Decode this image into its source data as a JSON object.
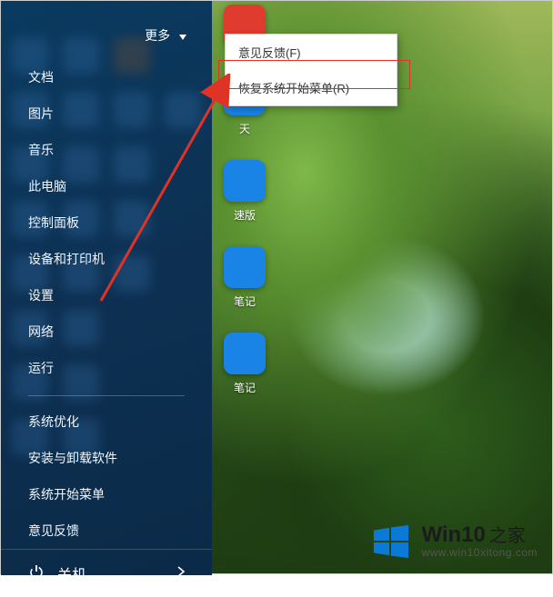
{
  "more_label": "更多",
  "menu_groups": {
    "g1": [
      "文档",
      "图片",
      "音乐",
      "此电脑",
      "控制面板",
      "设备和打印机",
      "设置",
      "网络",
      "运行"
    ],
    "g2": [
      "系统优化",
      "安装与卸载软件",
      "系统开始菜单",
      "意见反馈"
    ]
  },
  "shutdown_label": "关机",
  "context_menu": {
    "items": [
      "意见反馈(F)",
      "恢复系统开始菜单(R)"
    ]
  },
  "desktop_icons": [
    {
      "label": "",
      "color": "red"
    },
    {
      "label": "天"
    },
    {
      "label": "速版"
    },
    {
      "label": "笔记"
    },
    {
      "label": "笔记"
    }
  ],
  "watermark": {
    "title_main": "Win10",
    "title_suffix": "之家",
    "url": "www.win10xitong.com"
  }
}
